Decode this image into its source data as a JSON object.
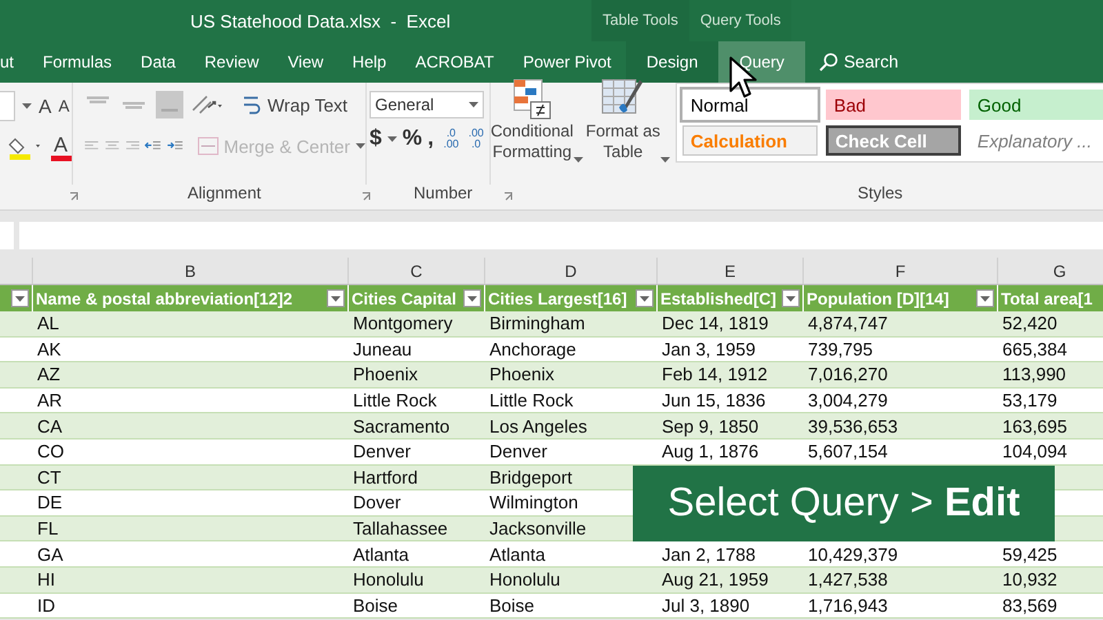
{
  "window": {
    "title": "US Statehood Data.xlsx  -  Excel"
  },
  "context_tabs": [
    {
      "label": "Table Tools"
    },
    {
      "label": "Query Tools"
    }
  ],
  "tabs": [
    {
      "label": "ut",
      "selected": false
    },
    {
      "label": "Formulas",
      "selected": false
    },
    {
      "label": "Data",
      "selected": false
    },
    {
      "label": "Review",
      "selected": false
    },
    {
      "label": "View",
      "selected": false
    },
    {
      "label": "Help",
      "selected": false
    },
    {
      "label": "ACROBAT",
      "selected": false
    },
    {
      "label": "Power Pivot",
      "selected": false
    },
    {
      "label": "Design",
      "selected": false
    },
    {
      "label": "Query",
      "selected": true
    }
  ],
  "search": {
    "label": "Search"
  },
  "ribbon": {
    "font_tools": [
      {
        "kind": "grow",
        "label": "A"
      },
      {
        "kind": "shrink",
        "label": "A"
      },
      {
        "kind": "fill"
      },
      {
        "kind": "font_color",
        "label": "A"
      }
    ],
    "wrap_text": {
      "label": "Wrap Text",
      "disabled": false
    },
    "merge": {
      "label": "Merge & Center",
      "disabled": true
    },
    "number_format": {
      "value": "General"
    },
    "number_symbols": [
      "$",
      "%",
      ","
    ],
    "decimal_buttons": [
      {
        "top": ".0",
        "bottom": ".00"
      },
      {
        "top": ".00",
        "bottom": ".0"
      }
    ],
    "conditional_formatting": {
      "lines": [
        "Conditional",
        "Formatting"
      ]
    },
    "format_as_table": {
      "lines": [
        "Format as",
        "Table"
      ]
    },
    "styles": [
      {
        "label": "Normal",
        "kind": "normal",
        "selected": true
      },
      {
        "label": "Bad",
        "kind": "bad",
        "selected": false
      },
      {
        "label": "Good",
        "kind": "good",
        "selected": false
      },
      {
        "label": "Calculation",
        "kind": "calculation",
        "selected": false
      },
      {
        "label": "Check Cell",
        "kind": "check",
        "selected": false
      },
      {
        "label": "Explanatory ...",
        "kind": "explanatory",
        "selected": false
      }
    ],
    "groups": [
      {
        "label": "Alignment"
      },
      {
        "label": "Number"
      },
      {
        "label": "Styles"
      }
    ]
  },
  "sheet": {
    "column_letters": [
      "B",
      "C",
      "D",
      "E",
      "F",
      "G"
    ],
    "columns": [
      "Name & postal abbreviation[12]2",
      "Cities Capital",
      "Cities Largest[16]",
      "Established[C]",
      "Population [D][14]",
      "Total area[1"
    ],
    "rows": [
      {
        "cells": [
          "AL",
          "Montgomery",
          "Birmingham",
          "Dec 14, 1819",
          "4,874,747",
          "52,420"
        ]
      },
      {
        "cells": [
          "AK",
          "Juneau",
          "Anchorage",
          "Jan 3, 1959",
          "739,795",
          "665,384"
        ]
      },
      {
        "cells": [
          "AZ",
          "Phoenix",
          "Phoenix",
          "Feb 14, 1912",
          "7,016,270",
          "113,990"
        ]
      },
      {
        "cells": [
          "AR",
          "Little Rock",
          "Little Rock",
          "Jun 15, 1836",
          "3,004,279",
          "53,179"
        ]
      },
      {
        "cells": [
          "CA",
          "Sacramento",
          "Los Angeles",
          "Sep 9, 1850",
          "39,536,653",
          "163,695"
        ]
      },
      {
        "cells": [
          "CO",
          "Denver",
          "Denver",
          "Aug 1, 1876",
          "5,607,154",
          "104,094"
        ]
      },
      {
        "cells": [
          "CT",
          "Hartford",
          "Bridgeport"
        ]
      },
      {
        "cells": [
          "DE",
          "Dover",
          "Wilmington"
        ]
      },
      {
        "cells": [
          "FL",
          "Tallahassee",
          "Jacksonville"
        ]
      },
      {
        "cells": [
          "GA",
          "Atlanta",
          "Atlanta",
          "Jan 2, 1788",
          "10,429,379",
          "59,425"
        ]
      },
      {
        "cells": [
          "HI",
          "Honolulu",
          "Honolulu",
          "Aug 21, 1959",
          "1,427,538",
          "10,932"
        ]
      },
      {
        "cells": [
          "ID",
          "Boise",
          "Boise",
          "Jul 3, 1890",
          "1,716,943",
          "83,569"
        ]
      }
    ]
  },
  "callout": {
    "text": "Select Query > **Edit**"
  }
}
